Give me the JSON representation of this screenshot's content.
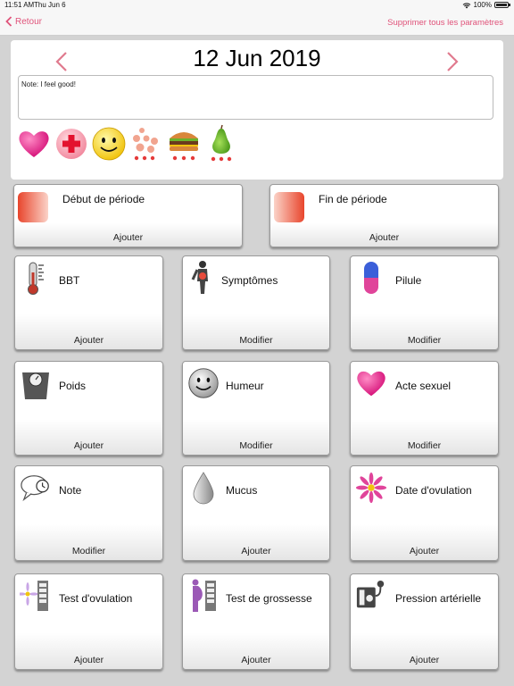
{
  "status": {
    "time": "11:51 AM",
    "date": "Thu Jun 6",
    "battery": "100%"
  },
  "nav": {
    "back_label": "Retour",
    "reset_label": "Supprimer tous les paramètres",
    "accent": "#e0537a"
  },
  "day": {
    "title": "12 Jun 2019",
    "note": "Note: I feel good!"
  },
  "quick_icons": [
    "heart-icon",
    "medical-cross-icon",
    "smiley-icon",
    "dots-cluster-icon",
    "burger-icon",
    "pear-icon"
  ],
  "period": {
    "start": {
      "label": "Début de période",
      "action": "Ajouter"
    },
    "end": {
      "label": "Fin de période",
      "action": "Ajouter"
    }
  },
  "tiles": [
    {
      "label": "BBT",
      "action": "Ajouter",
      "icon": "thermometer-icon"
    },
    {
      "label": "Symptômes",
      "action": "Modifier",
      "icon": "body-pain-icon"
    },
    {
      "label": "Pilule",
      "action": "Modifier",
      "icon": "pill-icon"
    },
    {
      "label": "Poids",
      "action": "Ajouter",
      "icon": "scale-icon"
    },
    {
      "label": "Humeur",
      "action": "Modifier",
      "icon": "smiley-icon"
    },
    {
      "label": "Acte sexuel",
      "action": "Modifier",
      "icon": "heart-icon"
    },
    {
      "label": "Note",
      "action": "Modifier",
      "icon": "speech-clock-icon"
    },
    {
      "label": "Mucus",
      "action": "Ajouter",
      "icon": "drop-icon"
    },
    {
      "label": "Date d'ovulation",
      "action": "Ajouter",
      "icon": "flower-icon"
    },
    {
      "label": "Test d'ovulation",
      "action": "Ajouter",
      "icon": "ovulation-test-icon"
    },
    {
      "label": "Test de grossesse",
      "action": "Ajouter",
      "icon": "pregnancy-test-icon"
    },
    {
      "label": "Pression artérielle",
      "action": "Ajouter",
      "icon": "blood-pressure-icon"
    }
  ]
}
